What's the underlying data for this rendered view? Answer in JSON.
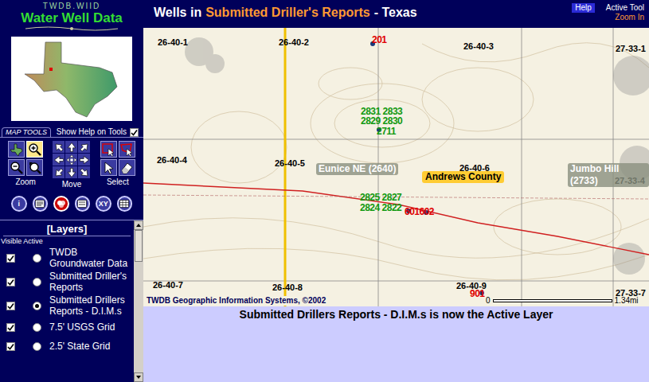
{
  "app": {
    "subtitle": "TWDB.WIID",
    "title": "Water Well Data"
  },
  "header": {
    "prefix": "Wells in",
    "highlight": "Submitted Driller's Reports",
    "suffix": "- Texas",
    "help": "Help",
    "active_tool_label": "Active Tool",
    "active_tool": "Zoom In"
  },
  "map_tools": {
    "title": "MAP TOOLS",
    "show_help_label": "Show Help on Tools",
    "show_help": true,
    "groups": [
      {
        "label": "Zoom",
        "tools": [
          {
            "kind": "full-extent",
            "selected": false
          },
          {
            "kind": "zoom-in",
            "selected": true
          },
          {
            "kind": "zoom-out",
            "selected": false
          },
          {
            "kind": "zoom-back",
            "selected": false
          }
        ]
      },
      {
        "label": "Move",
        "tools": [
          {
            "kind": "nw",
            "selected": false
          },
          {
            "kind": "n",
            "selected": false
          },
          {
            "kind": "ne",
            "selected": false
          },
          {
            "kind": "w",
            "selected": false
          },
          {
            "kind": "pan",
            "selected": false
          },
          {
            "kind": "e",
            "selected": false
          },
          {
            "kind": "sw",
            "selected": false
          },
          {
            "kind": "s",
            "selected": false
          },
          {
            "kind": "se",
            "selected": false
          }
        ]
      },
      {
        "label": "Select",
        "tools": [
          {
            "kind": "select-rect",
            "selected": false
          },
          {
            "kind": "select-poly",
            "selected": false
          },
          {
            "kind": "select-point",
            "selected": false
          },
          {
            "kind": "erase",
            "selected": false
          }
        ]
      }
    ],
    "round_tools": [
      {
        "kind": "info",
        "glyph": "i",
        "selected": false
      },
      {
        "kind": "legend",
        "glyph": "",
        "selected": false
      },
      {
        "kind": "layers",
        "glyph": "",
        "selected": true
      },
      {
        "kind": "report",
        "glyph": "",
        "selected": false
      },
      {
        "kind": "xy",
        "glyph": "XY",
        "selected": false
      },
      {
        "kind": "table",
        "glyph": "",
        "selected": false
      }
    ]
  },
  "layers": {
    "title": "[Layers]",
    "col_visible": "Visible",
    "col_active": "Active",
    "items": [
      {
        "label": "TWDB Groundwater Data",
        "visible": true,
        "selected": false
      },
      {
        "label": "Submitted Driller's Reports",
        "visible": true,
        "selected": false
      },
      {
        "label": "Submitted Drillers Reports - D.I.M.s",
        "visible": true,
        "selected": true
      },
      {
        "label": "7.5' USGS Grid",
        "visible": true,
        "selected": false
      },
      {
        "label": "2.5' State Grid",
        "visible": true,
        "selected": false
      }
    ]
  },
  "map": {
    "grid_labels": [
      "26-40-1",
      "26-40-2",
      "26-40-3",
      "27-33-1",
      "26-40-4",
      "26-40-5",
      "26-40-6",
      "27-33-4",
      "26-40-7",
      "26-40-8",
      "26-40-9",
      "27-33-7"
    ],
    "wells": [
      {
        "text": "201",
        "color": "#e00000"
      },
      {
        "text": "2831 2833",
        "color": "#119911"
      },
      {
        "text": "2829 2830",
        "color": "#119911"
      },
      {
        "text": "2711",
        "color": "#119911"
      },
      {
        "text": "2825 2827",
        "color": "#119911"
      },
      {
        "text": "2824 2822",
        "color": "#119911"
      },
      {
        "text": "601602",
        "color": "#e00000"
      },
      {
        "text": "901",
        "color": "#e00000"
      }
    ],
    "places": [
      {
        "text": "Eunice NE (2640)",
        "kind": "quad"
      },
      {
        "text": "Andrews County",
        "kind": "county"
      },
      {
        "text": "Jumbo Hill (2733)",
        "kind": "quad"
      }
    ],
    "copyright": "TWDB Geographic Information Systems, ©2002",
    "scale": {
      "start": "0",
      "end": "1.34mi"
    }
  },
  "status": "Submitted Drillers Reports - D.I.M.s is now the Active Layer"
}
